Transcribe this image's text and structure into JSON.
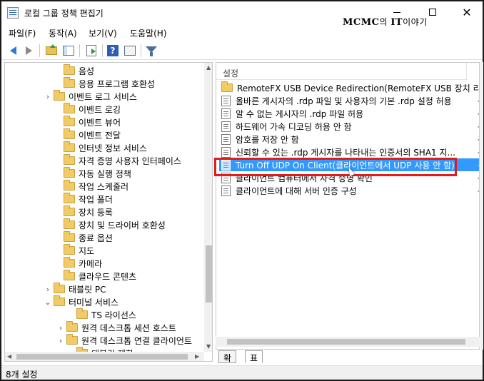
{
  "window": {
    "title": "로컬 그룹 정책 편집기",
    "watermark_brand": "MCMC",
    "watermark_mid": "의 ",
    "watermark_it": "IT",
    "watermark_tail": "이야기",
    "close_glyph": "✕"
  },
  "menu": {
    "items": [
      "파일(F)",
      "동작(A)",
      "보기(V)",
      "도움말(H)"
    ]
  },
  "tree": {
    "items": [
      {
        "label": "음성",
        "expander": ""
      },
      {
        "label": "응용 프로그램 호환성",
        "expander": ""
      },
      {
        "label": "이벤트 로그 서비스",
        "expander": "›"
      },
      {
        "label": "이벤트 로깅",
        "expander": ""
      },
      {
        "label": "이벤트 뷰어",
        "expander": ""
      },
      {
        "label": "이벤트 전달",
        "expander": ""
      },
      {
        "label": "인터넷 정보 서비스",
        "expander": ""
      },
      {
        "label": "자격 증명 사용자 인터페이스",
        "expander": ""
      },
      {
        "label": "자동 실행 정책",
        "expander": ""
      },
      {
        "label": "작업 스케줄러",
        "expander": ""
      },
      {
        "label": "작업 폴더",
        "expander": ""
      },
      {
        "label": "장치 등록",
        "expander": ""
      },
      {
        "label": "장치 및 드라이버 호환성",
        "expander": ""
      },
      {
        "label": "종료 옵션",
        "expander": ""
      },
      {
        "label": "지도",
        "expander": ""
      },
      {
        "label": "카메라",
        "expander": ""
      },
      {
        "label": "클라우드 콘텐츠",
        "expander": ""
      },
      {
        "label": "태블릿 PC",
        "expander": "›"
      },
      {
        "label": "터미널 서비스",
        "expander": "⌄"
      },
      {
        "label": "TS 라이선스",
        "expander": ""
      },
      {
        "label": "원격 데스크톱 세션 호스트",
        "expander": "›"
      },
      {
        "label": "원격 데스크톱 연결 클라이언트",
        "expander": "›"
      },
      {
        "label": "태블릿 제한",
        "expander": ""
      }
    ]
  },
  "list": {
    "column_header": "설정",
    "rows": [
      {
        "label": "RemoteFX USB Device Redirection(RemoteFX USB 장치 리...",
        "trail": "",
        "kind": "folder"
      },
      {
        "label": "올바른 게시자의 .rdp 파일 및 사용자의 기본 .rdp 설정 허용",
        "trail": "구",
        "kind": "setting"
      },
      {
        "label": "알 수 없는 게시자의 .rdp 파일 허용",
        "trail": "구",
        "kind": "setting"
      },
      {
        "label": "하드웨어 가속 디코딩 허용 안 함",
        "trail": "구",
        "kind": "setting"
      },
      {
        "label": "암호를 저장 안 함",
        "trail": "구",
        "kind": "setting"
      },
      {
        "label": "신뢰할 수 있는 .rdp 게시자를 나타내는 인증서의 SHA1 지...",
        "trail": "구",
        "kind": "setting"
      },
      {
        "label": "Turn Off UDP On Client(클라이언트에서 UDP 사용 안 함)",
        "trail": "구",
        "kind": "setting",
        "selected": true
      },
      {
        "label": "클라이언트 컴퓨터에서 자격 증명 확인",
        "trail": "구",
        "kind": "setting"
      },
      {
        "label": "클라이언트에 대해 서버 인증 구성",
        "trail": "구",
        "kind": "setting"
      }
    ]
  },
  "tabs": [
    "확장",
    "표준"
  ],
  "status": {
    "text": "8개 설정"
  },
  "colors": {
    "selection": "#3399ff",
    "highlight_border": "#e41b1b",
    "folder": "#f2cb66"
  }
}
